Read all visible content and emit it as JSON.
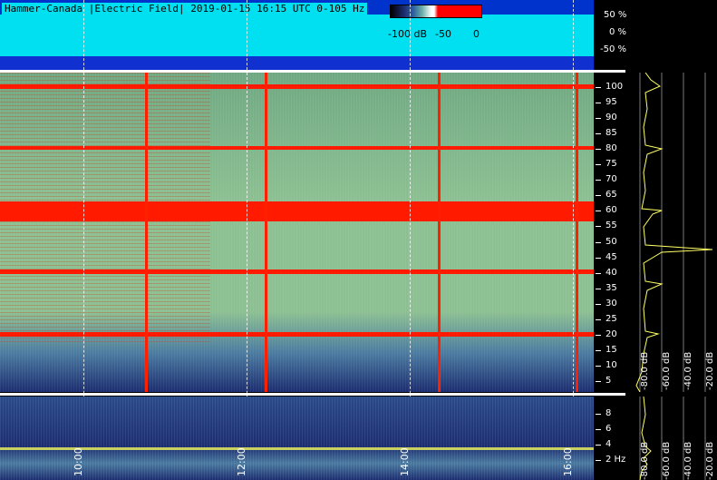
{
  "header": {
    "title": "Hammer-Canada |Electric Field| 2019-01-15 16:15 UTC 0-105 Hz"
  },
  "colorbar": {
    "labels": [
      "-100 dB",
      "-50",
      "0"
    ]
  },
  "amplitude_axis": {
    "ticks": [
      "50 %",
      "0 %",
      "-50 %"
    ]
  },
  "frequency_axis": {
    "main_ticks": [
      "100",
      "95",
      "90",
      "85",
      "80",
      "75",
      "70",
      "65",
      "60",
      "55",
      "50",
      "45",
      "40",
      "35",
      "30",
      "25",
      "20",
      "15",
      "10",
      "5"
    ],
    "low_ticks": [
      "8",
      "6",
      "4",
      "2 Hz"
    ]
  },
  "time_axis": {
    "labels": [
      "10:00",
      "12:00",
      "14:00",
      "16:00"
    ]
  },
  "spectrum_axis": {
    "db_labels_main": [
      "-80.0 dB",
      "-60.0 dB",
      "-40.0 dB",
      "-20.0 dB"
    ],
    "db_labels_low": [
      "-80.0 dB",
      "-60.0 dB",
      "-40.0 dB",
      "-20.0 dB"
    ]
  },
  "colors": {
    "band": "#ff1a00",
    "amplitude_bg": "#00e0f0",
    "spectrum_line": "#ffff66"
  }
}
